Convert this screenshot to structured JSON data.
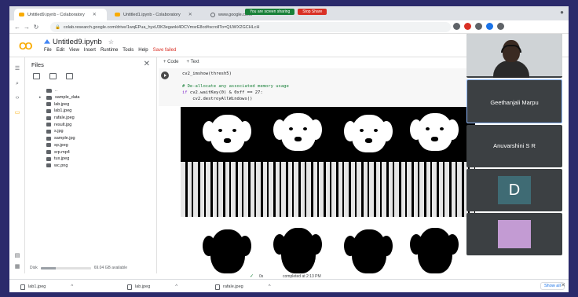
{
  "browser": {
    "tabs": [
      {
        "label": "Untitled9.ipynb - Colaboratory",
        "active": true
      },
      {
        "label": "Untitled1.ipynb - Colaboratory",
        "active": false
      },
      {
        "label": "www.google.co.in",
        "active": false
      }
    ],
    "screen_share_message": "You are screen sharing",
    "stop_share_label": "Stop Share",
    "url": "colab.research.google.com/drive/1wqEPua_hyxU3K3eganki4DCVmsrE8cd#scrollTo=QUWX2GCHLcH"
  },
  "colab": {
    "notebook_title": "Untitled9.ipynb",
    "menu": [
      "File",
      "Edit",
      "View",
      "Insert",
      "Runtime",
      "Tools",
      "Help"
    ],
    "save_status": "Save failed",
    "add_code_label": "+ Code",
    "add_text_label": "+ Text"
  },
  "files": {
    "title": "Files",
    "tree": [
      {
        "name": "..",
        "kind": "folder",
        "caret": ""
      },
      {
        "name": "sample_data",
        "kind": "folder",
        "caret": "▸"
      },
      {
        "name": "lab.jpeg",
        "kind": "file",
        "caret": ""
      },
      {
        "name": "lab1.jpeg",
        "kind": "file",
        "caret": ""
      },
      {
        "name": "rafale.jpeg",
        "kind": "file",
        "caret": ""
      },
      {
        "name": "result.jpg",
        "kind": "file",
        "caret": ""
      },
      {
        "name": "s.jpg",
        "kind": "file",
        "caret": ""
      },
      {
        "name": "sample.jpg",
        "kind": "file",
        "caret": ""
      },
      {
        "name": "sp.jpeg",
        "kind": "file",
        "caret": ""
      },
      {
        "name": "srp.mp4",
        "kind": "file",
        "caret": ""
      },
      {
        "name": "tux.jpeg",
        "kind": "file",
        "caret": ""
      },
      {
        "name": "wc.png",
        "kind": "file",
        "caret": ""
      }
    ],
    "disk_label": "Disk",
    "disk_available": "69.04 GB available",
    "disk_used_fraction": 0.3
  },
  "code_cell": {
    "line1": "cv2_imshow(thresh5)",
    "comment": "# De-allocate any associated memory usage",
    "line3_kw": "if",
    "line3_rest": " cv2.waitKey(0) & 0xff == 27:",
    "line4": "    cv2.destroyAllWindows()"
  },
  "status": {
    "elapsed": "0s",
    "completed": "completed at 2:13 PM"
  },
  "downloads": {
    "items": [
      "lab1.jpeg",
      "lab.jpeg",
      "rafale.jpeg"
    ],
    "show_all_label": "Show all"
  },
  "meet": {
    "participants": [
      {
        "name": "",
        "kind": "video"
      },
      {
        "name": "Geethanjali Marpu",
        "kind": "name-only"
      },
      {
        "name": "Anuvarshini S R",
        "kind": "name-only"
      },
      {
        "name": "",
        "kind": "avatar-letter",
        "letter": "D",
        "color": "#3f6b74"
      },
      {
        "name": "",
        "kind": "avatar-color",
        "color": "#c39bd3"
      }
    ]
  },
  "colors": {
    "page_bg": "#2b2a6b",
    "colab_orange": "#f9ab00",
    "save_failed_red": "#d93025",
    "share_green": "#188038"
  }
}
